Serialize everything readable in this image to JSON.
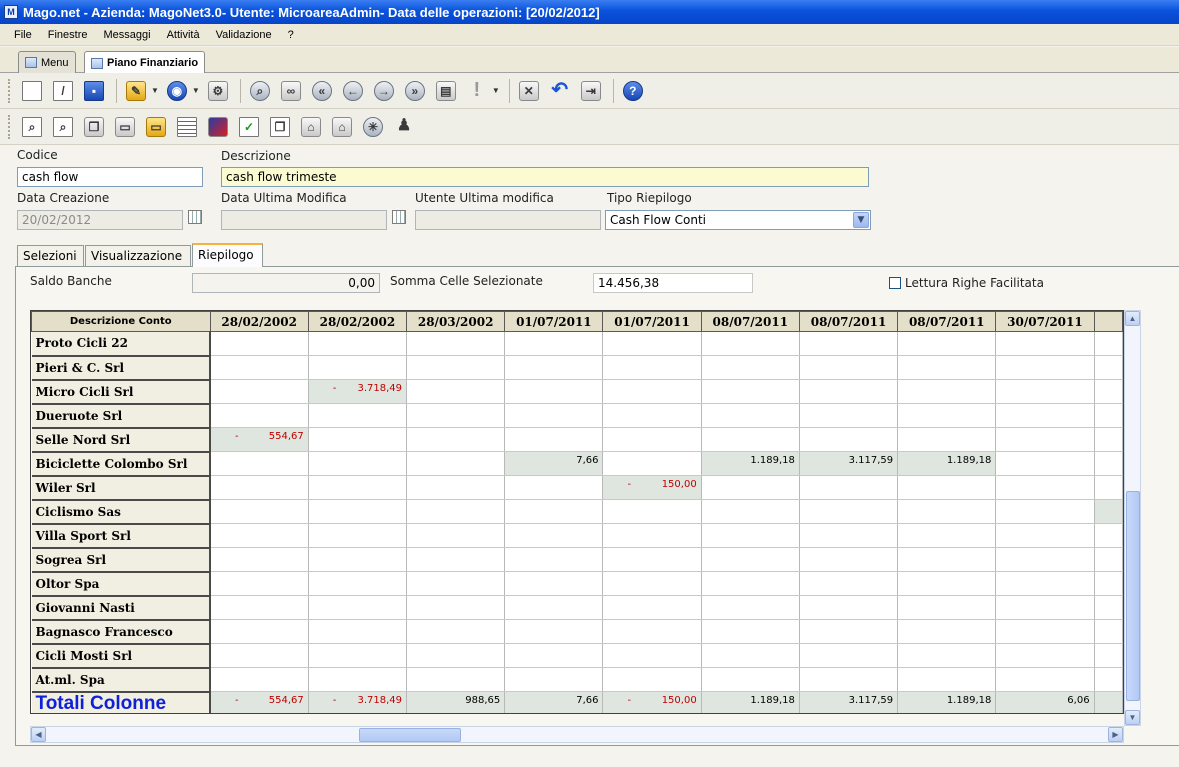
{
  "window": {
    "title": "Mago.net - Azienda: MagoNet3.0- Utente: MicroareaAdmin- Data delle operazioni: [20/02/2012]",
    "app_icon": "M"
  },
  "menu": [
    "File",
    "Finestre",
    "Messaggi",
    "Attività",
    "Validazione",
    "?"
  ],
  "doc_tabs": {
    "menu": "Menu",
    "active": "Piano Finanziario"
  },
  "toolbar1_icons": [
    "new-doc-icon",
    "edit-doc-icon",
    "save-icon",
    "edit-menu-icon",
    "search-globe-icon",
    "settings-icon",
    "find-icon",
    "binoculars-icon",
    "first-record-icon",
    "prev-record-icon",
    "next-record-icon",
    "last-record-icon",
    "clipboard-icon",
    "exclamation-icon",
    "cancel-icon",
    "undo-icon",
    "exit-icon",
    "help-icon"
  ],
  "toolbar2_icons": [
    "preview-icon",
    "print-preview-icon",
    "copy-icon",
    "open-icon",
    "open-folder-icon",
    "table-icon",
    "radar-icon",
    "checklist-icon",
    "duplicate-icon",
    "house-icon",
    "house-star-icon",
    "compass-icon",
    "person-icon"
  ],
  "form": {
    "codice_label": "Codice",
    "codice_value": "cash flow",
    "descrizione_label": "Descrizione",
    "descrizione_value": "cash flow trimeste",
    "data_creazione_label": "Data Creazione",
    "data_creazione_value": "20/02/2012",
    "data_ultima_modifica_label": "Data Ultima Modifica",
    "data_ultima_modifica_value": "",
    "utente_ultima_modifica_label": "Utente Ultima modifica",
    "utente_ultima_modifica_value": "",
    "tipo_riepilogo_label": "Tipo Riepilogo",
    "tipo_riepilogo_value": "Cash Flow Conti"
  },
  "tabs": [
    "Selezioni",
    "Visualizzazione",
    "Riepilogo"
  ],
  "summary": {
    "saldo_banche_label": "Saldo Banche",
    "saldo_banche_value": "0,00",
    "somma_celle_label": "Somma Celle Selezionate",
    "somma_celle_value": "14.456,38",
    "lettura_righe_label": "Lettura Righe Facilitata"
  },
  "grid": {
    "header_descr": "Descrizione Conto",
    "columns": [
      "28/02/2002",
      "28/02/2002",
      "28/03/2002",
      "01/07/2011",
      "01/07/2011",
      "08/07/2011",
      "08/07/2011",
      "08/07/2011",
      "30/07/2011"
    ],
    "rows": [
      {
        "name": "Proto Cicli 22",
        "cells": [
          "",
          "",
          "",
          "",
          "",
          "",
          "",
          "",
          ""
        ]
      },
      {
        "name": "Pieri & C. Srl",
        "cells": [
          "",
          "",
          "",
          "",
          "",
          "",
          "",
          "",
          ""
        ]
      },
      {
        "name": "Micro Cicli Srl",
        "cells": [
          "",
          "-3.718,49",
          "",
          "",
          "",
          "",
          "",
          "",
          ""
        ]
      },
      {
        "name": "Dueruote Srl",
        "cells": [
          "",
          "",
          "",
          "",
          "",
          "",
          "",
          "",
          ""
        ]
      },
      {
        "name": "Selle Nord Srl",
        "cells": [
          "-554,67",
          "",
          "",
          "",
          "",
          "",
          "",
          "",
          ""
        ]
      },
      {
        "name": "Biciclette Colombo Srl",
        "cells": [
          "",
          "",
          "",
          "7,66",
          "",
          "1.189,18",
          "3.117,59",
          "1.189,18",
          ""
        ]
      },
      {
        "name": "Wiler Srl",
        "cells": [
          "",
          "",
          "",
          "",
          "-150,00",
          "",
          "",
          "",
          ""
        ]
      },
      {
        "name": "Ciclismo Sas",
        "cells": [
          "",
          "",
          "",
          "",
          "",
          "",
          "",
          "",
          ""
        ]
      },
      {
        "name": "Villa Sport Srl",
        "cells": [
          "",
          "",
          "",
          "",
          "",
          "",
          "",
          "",
          ""
        ]
      },
      {
        "name": "Sogrea Srl",
        "cells": [
          "",
          "",
          "",
          "",
          "",
          "",
          "",
          "",
          ""
        ]
      },
      {
        "name": "Oltor Spa",
        "cells": [
          "",
          "",
          "",
          "",
          "",
          "",
          "",
          "",
          ""
        ]
      },
      {
        "name": "Giovanni Nasti",
        "cells": [
          "",
          "",
          "",
          "",
          "",
          "",
          "",
          "",
          ""
        ]
      },
      {
        "name": "Bagnasco Francesco",
        "cells": [
          "",
          "",
          "",
          "",
          "",
          "",
          "",
          "",
          ""
        ]
      },
      {
        "name": "Cicli Mosti Srl",
        "cells": [
          "",
          "",
          "",
          "",
          "",
          "",
          "",
          "",
          ""
        ]
      },
      {
        "name": "At.ml. Spa",
        "cells": [
          "",
          "",
          "",
          "",
          "",
          "",
          "",
          "",
          ""
        ]
      }
    ],
    "totals_label": "Totali Colonne",
    "totals": [
      "-554,67",
      "-3.718,49",
      "988,65",
      "7,66",
      "-150,00",
      "1.189,18",
      "3.117,59",
      "1.189,18",
      "6,06"
    ]
  },
  "colors": {
    "negative": "#c00000",
    "totals_label": "#1020d8",
    "highlight_cell": "#dfe6df"
  }
}
